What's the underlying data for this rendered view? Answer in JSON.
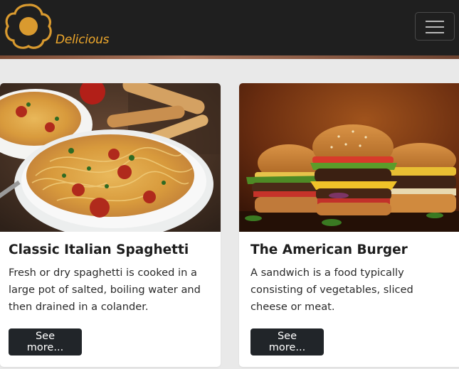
{
  "navbar": {
    "brand": "Delicious",
    "logo_icon": "fried-egg-icon",
    "toggle_icon": "hamburger-menu-icon",
    "brand_color": "#f0a92c",
    "background": "#1f1f1f"
  },
  "cards": [
    {
      "image_icon": "spaghetti-plate-photo",
      "title": "Classic Italian Spaghetti",
      "text": "Fresh or dry spaghetti is cooked in a large pot of salted, boiling water and then drained in a colander.",
      "button": "See more..."
    },
    {
      "image_icon": "burgers-photo",
      "title": "The American Burger",
      "text": "A sandwich is a food typically consisting of vegetables, sliced cheese or meat.",
      "button": "See more..."
    }
  ]
}
